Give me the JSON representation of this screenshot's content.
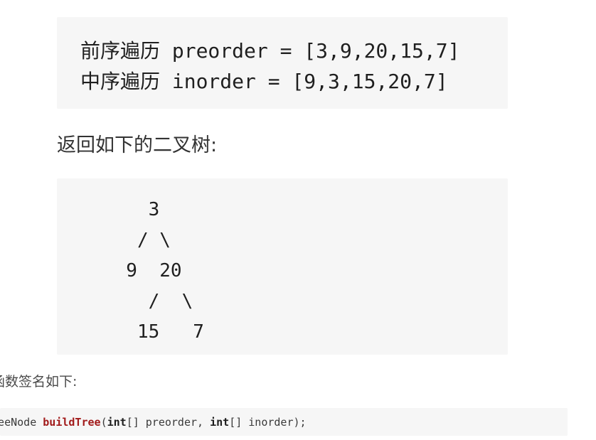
{
  "example_input": {
    "preorder_line": "前序遍历 preorder = [3,9,20,15,7]",
    "inorder_line": "中序遍历 inorder = [9,3,15,20,7]"
  },
  "caption": "返回如下的二叉树:",
  "tree": {
    "line1": "    3",
    "line2": "   / \\",
    "line3": "  9  20",
    "line4": "    /  \\",
    "line5": "   15   7"
  },
  "signature": {
    "title": "函数签名如下:",
    "return_type": "TreeNode",
    "function_name": "buildTree",
    "open_paren": "(",
    "param1_type": "int",
    "param1_rest": "[] preorder, ",
    "param2_type": "int",
    "param2_rest": "[] inorder);"
  }
}
